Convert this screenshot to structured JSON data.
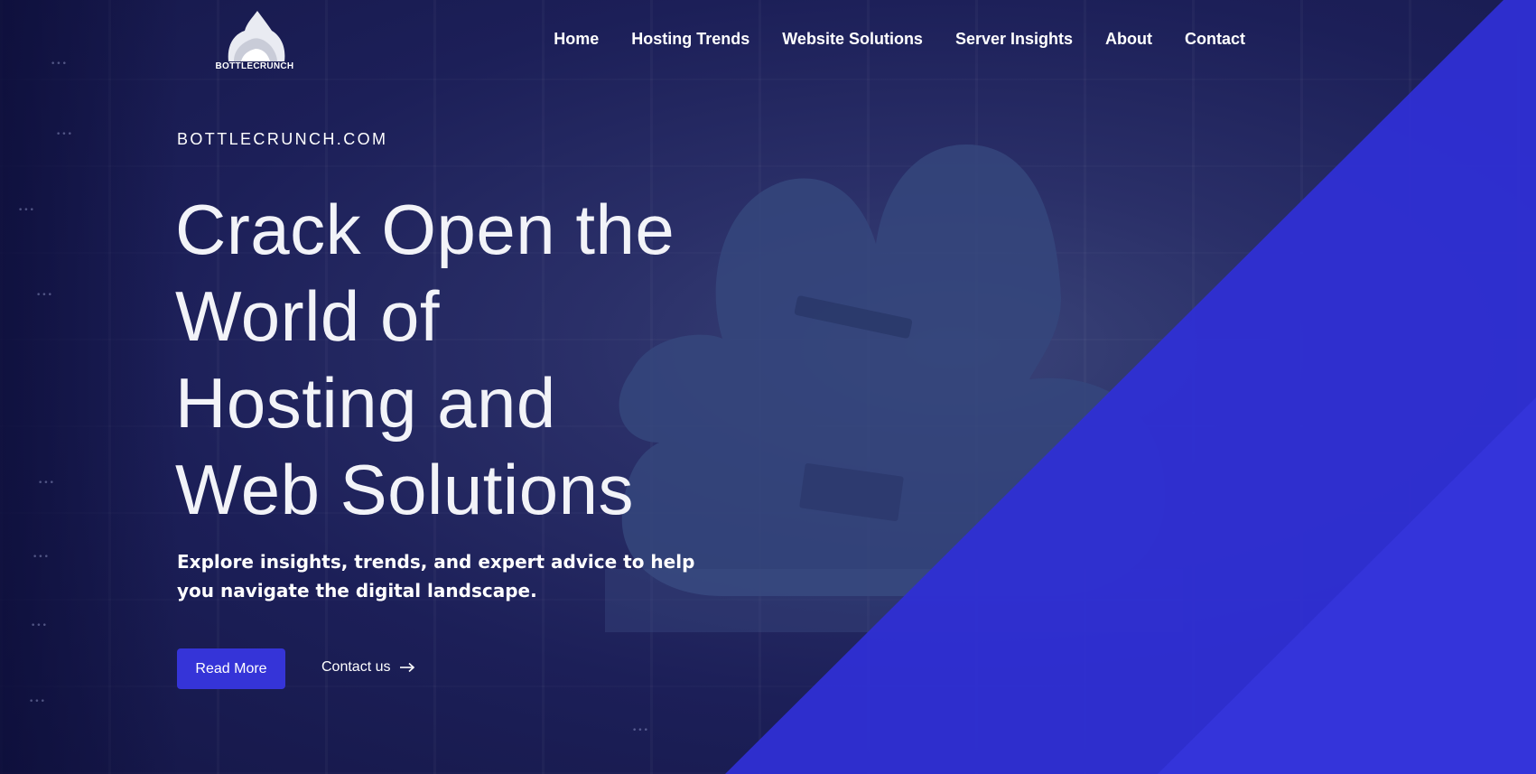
{
  "brand": {
    "name": "BOTTLECRUNCH"
  },
  "nav": {
    "items": [
      {
        "label": "Home"
      },
      {
        "label": "Hosting Trends"
      },
      {
        "label": "Website Solutions"
      },
      {
        "label": "Server Insights"
      },
      {
        "label": "About"
      },
      {
        "label": "Contact"
      }
    ]
  },
  "hero": {
    "eyebrow": "BOTTLECRUNCH.COM",
    "headline_lines": [
      "Crack Open the",
      "World of",
      "Hosting and",
      "Web Solutions"
    ],
    "subtext": "Explore insights, trends, and expert advice to help you navigate the digital landscape.",
    "primary_button": "Read More",
    "secondary_link": "Contact us",
    "secondary_icon": "arrow-right-icon"
  },
  "colors": {
    "accent": "#3534d8",
    "background": "#1a1c55",
    "text": "#ffffff"
  }
}
